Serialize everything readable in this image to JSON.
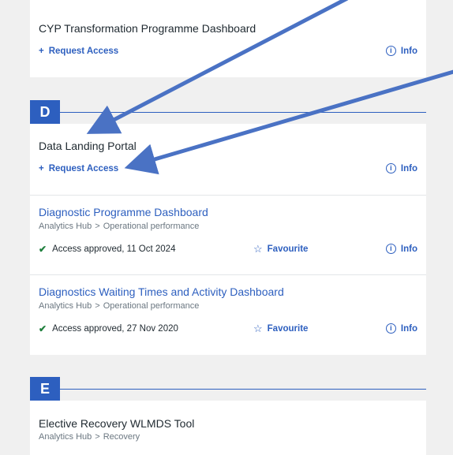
{
  "cards_top": {
    "title": "CYP Transformation Programme Dashboard",
    "request": "Request Access",
    "info": "Info"
  },
  "section_d": {
    "letter": "D",
    "items": [
      {
        "title": "Data Landing Portal",
        "request": "Request Access",
        "info": "Info"
      },
      {
        "title": "Diagnostic Programme Dashboard",
        "crumb_a": "Analytics Hub",
        "crumb_sep": ">",
        "crumb_b": "Operational performance",
        "status": "Access approved, 11 Oct 2024",
        "fav": "Favourite",
        "info": "Info"
      },
      {
        "title": "Diagnostics Waiting Times and Activity Dashboard",
        "crumb_a": "Analytics Hub",
        "crumb_sep": ">",
        "crumb_b": "Operational performance",
        "status": "Access approved, 27 Nov 2020",
        "fav": "Favourite",
        "info": "Info"
      }
    ]
  },
  "section_e": {
    "letter": "E",
    "items": [
      {
        "title": "Elective Recovery WLMDS Tool",
        "crumb_a": "Analytics Hub",
        "crumb_sep": ">",
        "crumb_b": "Recovery"
      }
    ]
  },
  "colors": {
    "brand": "#2d5fbf",
    "approved": "#1e7f3c",
    "background": "#f0f0f0"
  }
}
